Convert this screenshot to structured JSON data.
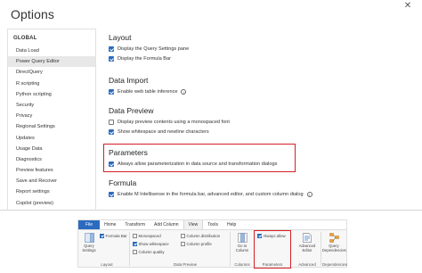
{
  "dialog": {
    "title": "Options",
    "close_glyph": "✕"
  },
  "sidebar": {
    "heading": "GLOBAL",
    "items": [
      {
        "label": "Data Load"
      },
      {
        "label": "Power Query Editor",
        "active": true
      },
      {
        "label": "DirectQuery"
      },
      {
        "label": "R scripting"
      },
      {
        "label": "Python scripting"
      },
      {
        "label": "Security"
      },
      {
        "label": "Privacy"
      },
      {
        "label": "Regional Settings"
      },
      {
        "label": "Updates"
      },
      {
        "label": "Usage Data"
      },
      {
        "label": "Diagnostics"
      },
      {
        "label": "Preview features"
      },
      {
        "label": "Save and Recover"
      },
      {
        "label": "Report settings"
      },
      {
        "label": "Copilot (preview)"
      }
    ]
  },
  "sections": {
    "layout": {
      "title": "Layout",
      "options": [
        {
          "label": "Display the Query Settings pane",
          "checked": true
        },
        {
          "label": "Display the Formula Bar",
          "checked": true
        }
      ]
    },
    "data_import": {
      "title": "Data Import",
      "options": [
        {
          "label": "Enable web table inference",
          "checked": true,
          "info": true
        }
      ]
    },
    "data_preview": {
      "title": "Data Preview",
      "options": [
        {
          "label": "Display preview contents using a monospaced font",
          "checked": false
        },
        {
          "label": "Show whitespace and newline characters",
          "checked": true
        }
      ]
    },
    "parameters": {
      "title": "Parameters",
      "options": [
        {
          "label": "Always allow parameterization in data source and transformation dialogs",
          "checked": true
        }
      ]
    },
    "formula": {
      "title": "Formula",
      "options": [
        {
          "label": "Enable M Intellisense in the formula bar, advanced editor, and custom column dialog",
          "checked": true,
          "info": true
        }
      ]
    }
  },
  "ribbon": {
    "tabs": [
      "File",
      "Home",
      "Transform",
      "Add Column",
      "View",
      "Tools",
      "Help"
    ],
    "active_tab": "View",
    "query_settings_label_1": "Query",
    "query_settings_label_2": "Settings",
    "formula_bar_label": "Formula Bar",
    "monospaced_label": "Monospaced",
    "show_whitespace_label": "Show whitespace",
    "column_quality_label": "Column quality",
    "column_distribution_label": "Column distribution",
    "column_profile_label": "Column profile",
    "go_to_column_label_1": "Go to",
    "go_to_column_label_2": "Column",
    "always_allow_label": "Always allow",
    "advanced_editor_label_1": "Advanced",
    "advanced_editor_label_2": "Editor",
    "query_dependencies_label_1": "Query",
    "query_dependencies_label_2": "Dependencies",
    "groups": {
      "layout": "Layout",
      "data_preview": "Data Preview",
      "columns": "Columns",
      "parameters": "Parameters",
      "advanced": "Advanced",
      "dependencies": "Dependencies"
    }
  },
  "colors": {
    "accent": "#2b6bbf",
    "highlight": "#d42027"
  }
}
